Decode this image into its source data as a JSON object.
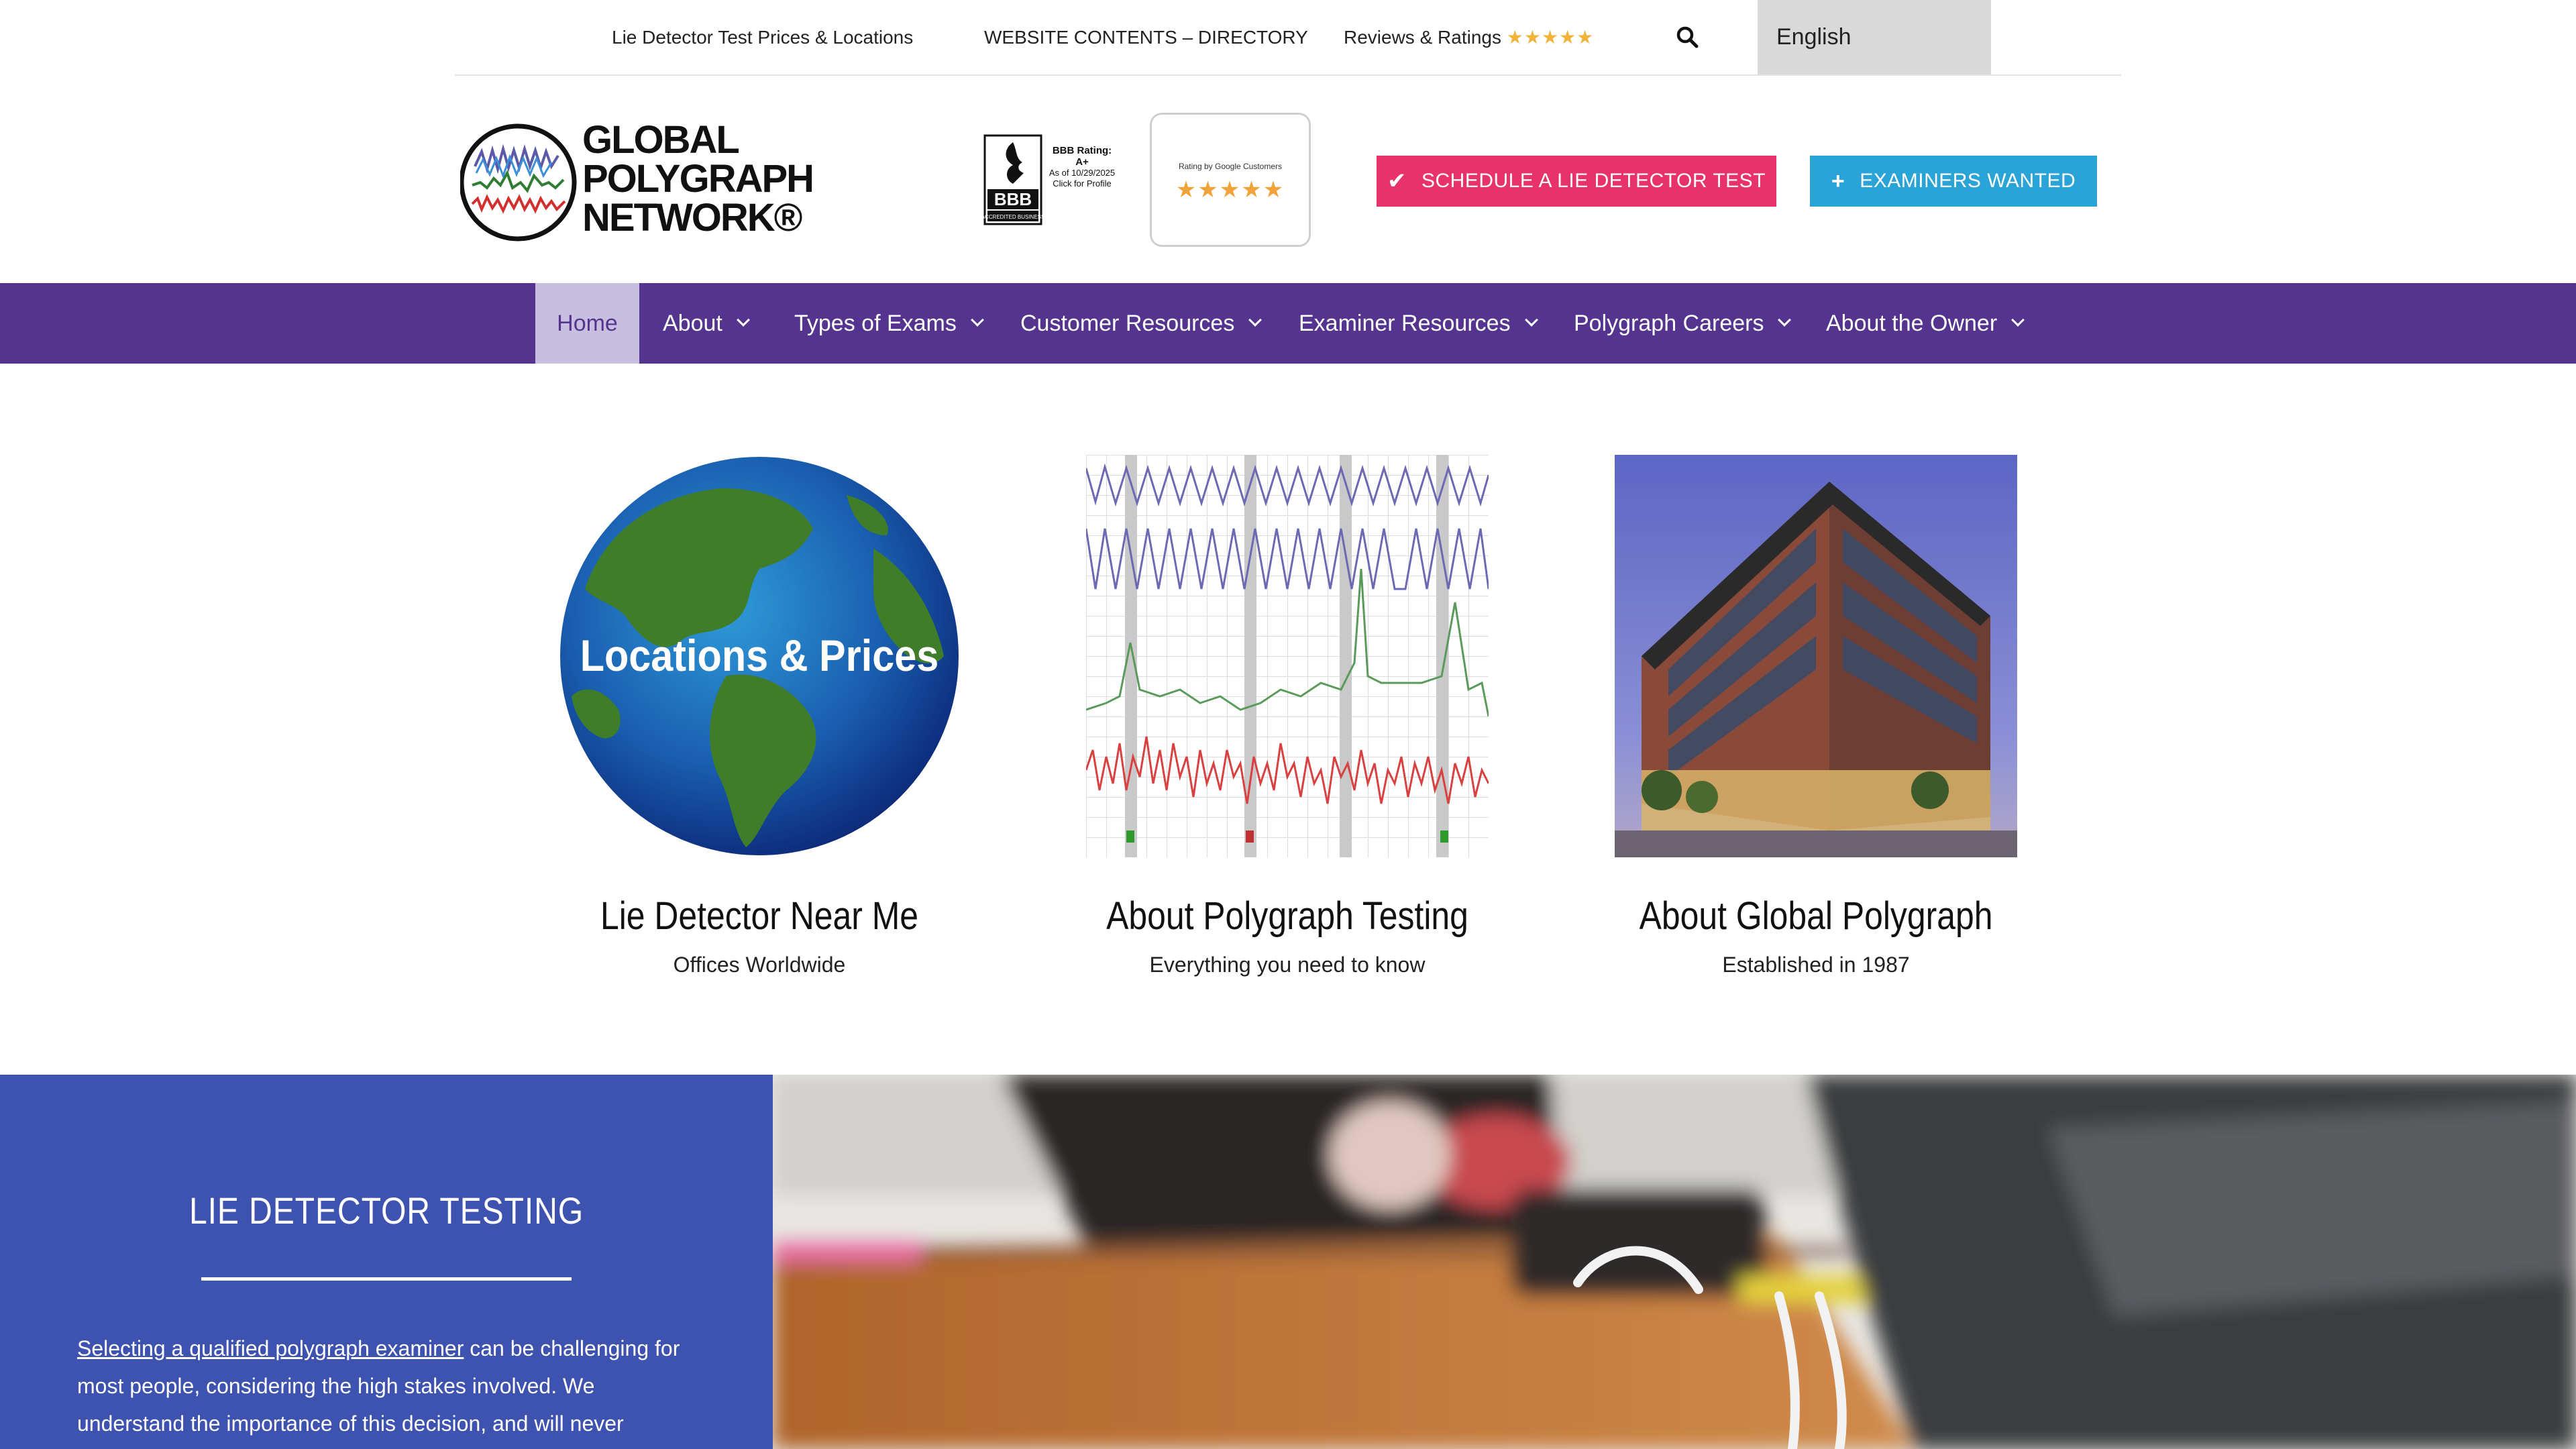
{
  "topbar": {
    "links": [
      {
        "label": "Lie Detector Test Prices & Locations"
      },
      {
        "label": "WEBSITE CONTENTS – DIRECTORY"
      },
      {
        "label": "Reviews & Ratings",
        "stars": "★★★★★"
      }
    ],
    "search_icon": "search-icon",
    "language": "English"
  },
  "header": {
    "logo": {
      "line1": "GLOBAL",
      "line2": "POLYGRAPH",
      "line3": "NETWORK®"
    },
    "bbb": {
      "badge_text": "BBB",
      "badge_sub": "ACCREDITED BUSINESS",
      "rating_label": "BBB Rating:",
      "rating": "A+",
      "as_of": "As of 10/29/2025",
      "click": "Click for Profile"
    },
    "google": {
      "label": "Rating by Google Customers",
      "stars": "★★★★★"
    },
    "buttons": {
      "schedule": "SCHEDULE A LIE DETECTOR TEST",
      "examiners": "EXAMINERS WANTED"
    }
  },
  "nav": {
    "items": [
      {
        "label": "Home",
        "active": true
      },
      {
        "label": "About"
      },
      {
        "label": "Types of Exams"
      },
      {
        "label": "Customer Resources"
      },
      {
        "label": "Examiner Resources"
      },
      {
        "label": "Polygraph Careers"
      },
      {
        "label": "About the Owner"
      }
    ]
  },
  "cards": [
    {
      "overlay": "Locations & Prices",
      "title": "Lie Detector Near Me",
      "subtitle": "Offices Worldwide"
    },
    {
      "title": "About Polygraph Testing",
      "subtitle": "Everything you need to know"
    },
    {
      "title": "About Global Polygraph",
      "subtitle": "Established in 1987"
    }
  ],
  "section": {
    "title": "LIE DETECTOR TESTING",
    "link_text": "Selecting a qualified polygraph examiner",
    "text_lines": [
      " can be challenging for",
      "most people, considering the high stakes involved. We",
      "understand the importance of this decision, and will never"
    ]
  },
  "colors": {
    "nav_bg": "#55348f",
    "nav_active_bg": "#c8bfe0",
    "schedule_button": "#e8326c",
    "examiners_button": "#2aa3d6",
    "section_bg": "#3e52b0",
    "stars": "#f1b43a"
  }
}
